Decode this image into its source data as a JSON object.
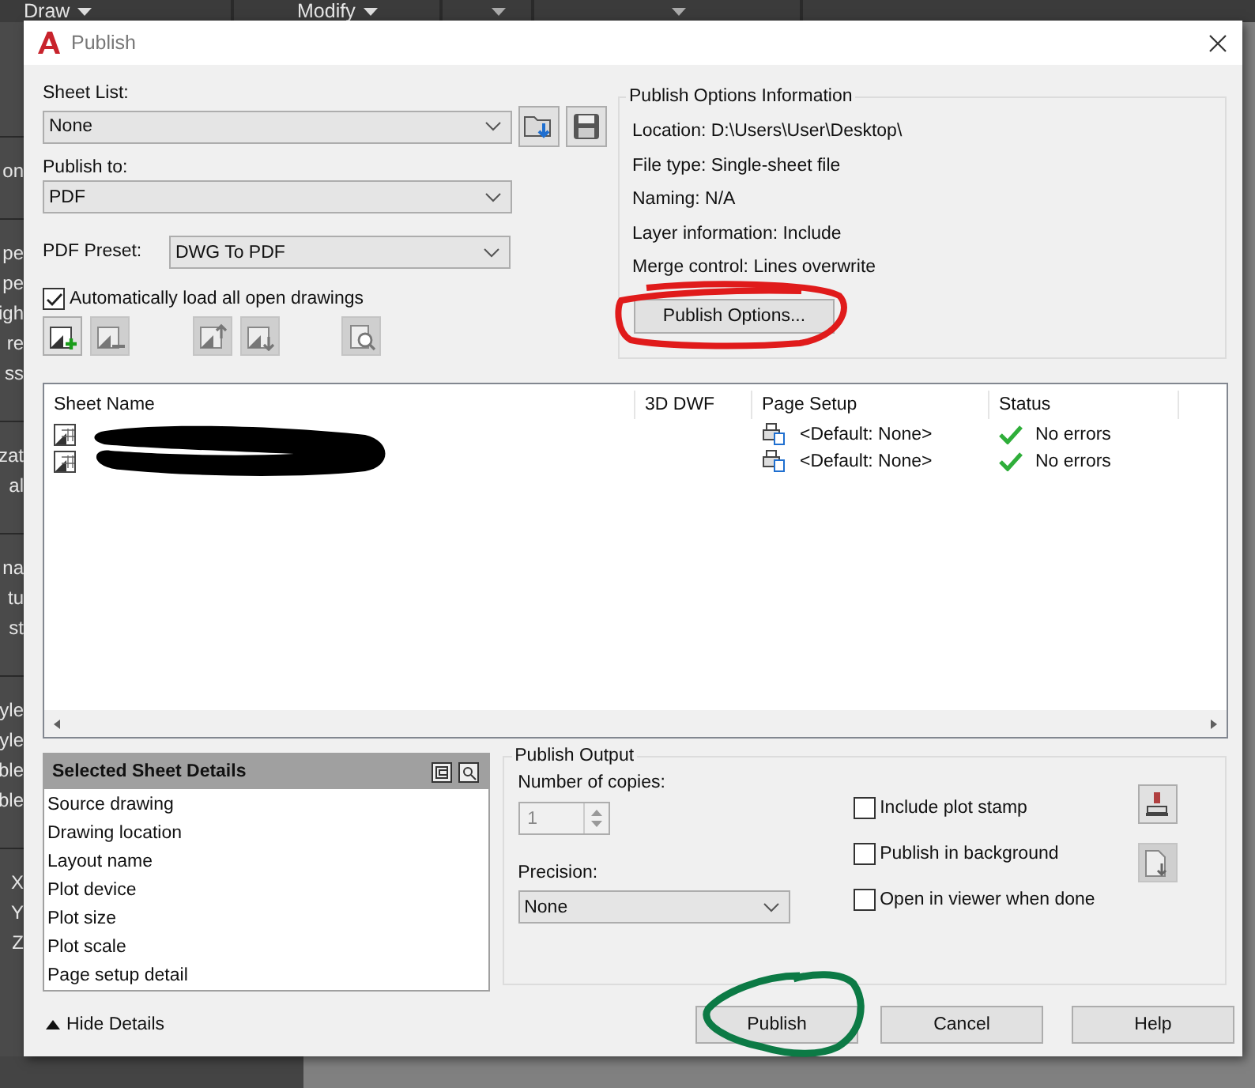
{
  "ribbon_panels": [
    "Draw",
    "Modify"
  ],
  "side_palette": [
    [
      "on"
    ],
    [
      "pe",
      "pe",
      "igh",
      "re",
      "ss"
    ],
    [
      "zat",
      "al"
    ],
    [
      "na",
      "tu",
      "st"
    ],
    [
      "yle",
      "yle",
      "ble",
      "ble"
    ],
    [
      "X",
      "Y",
      "Z"
    ]
  ],
  "dialog": {
    "title": "Publish",
    "sheet_list": {
      "label": "Sheet List:",
      "value": "None"
    },
    "publish_to": {
      "label": "Publish to:",
      "value": "PDF"
    },
    "pdf_preset": {
      "label": "PDF Preset:",
      "value": "DWG To PDF"
    },
    "auto_load": {
      "label": "Automatically load all open drawings",
      "checked": true
    },
    "options_info": {
      "title": "Publish Options Information",
      "lines": [
        "Location: D:\\Users\\User\\Desktop\\",
        "File type: Single-sheet file",
        "Naming: N/A",
        "Layer information: Include",
        "Merge control: Lines overwrite"
      ],
      "button": "Publish Options..."
    },
    "table": {
      "columns": [
        "Sheet Name",
        "3D DWF",
        "Page Setup",
        "Status"
      ],
      "rows": [
        {
          "page_setup": "<Default: None>",
          "status": "No errors"
        },
        {
          "page_setup": "<Default: None>",
          "status": "No errors"
        }
      ]
    },
    "details": {
      "title": "Selected Sheet Details",
      "items": [
        "Source drawing",
        "Drawing location",
        "Layout name",
        "Plot device",
        "Plot size",
        "Plot scale",
        "Page setup detail"
      ]
    },
    "output": {
      "title": "Publish Output",
      "copies_label": "Number of copies:",
      "copies_value": "1",
      "copies_disabled": true,
      "precision_label": "Precision:",
      "precision_value": "None",
      "options": [
        {
          "label": "Include plot stamp",
          "checked": false
        },
        {
          "label": "Publish in background",
          "checked": false
        },
        {
          "label": "Open in viewer when done",
          "checked": false
        }
      ]
    },
    "hide_details": "Hide Details",
    "buttons": [
      "Publish",
      "Cancel",
      "Help"
    ]
  }
}
